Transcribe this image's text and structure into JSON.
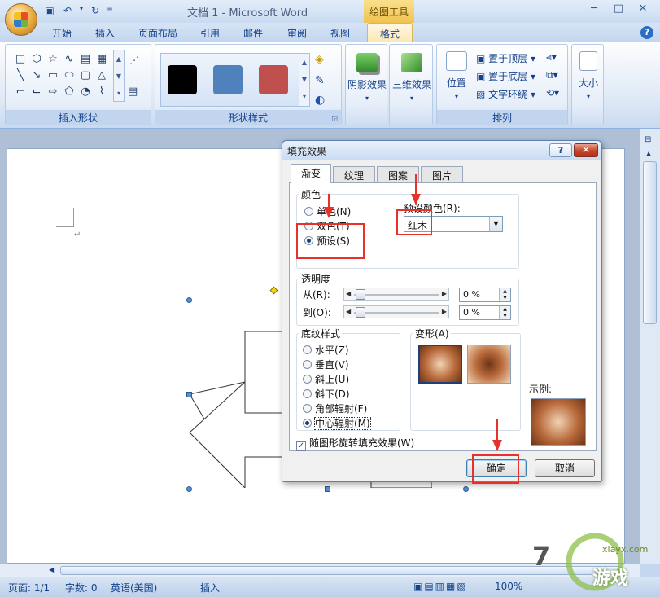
{
  "window": {
    "title": "文档 1 - Microsoft Word",
    "contextual_tab_header": "绘图工具"
  },
  "tabs": [
    {
      "label": "开始"
    },
    {
      "label": "插入"
    },
    {
      "label": "页面布局"
    },
    {
      "label": "引用"
    },
    {
      "label": "邮件"
    },
    {
      "label": "审阅"
    },
    {
      "label": "视图"
    },
    {
      "label": "格式",
      "active": true
    }
  ],
  "ribbon": {
    "insert_shapes_label": "插入形状",
    "shape_styles_label": "形状样式",
    "arrange_label": "排列",
    "shadow_effects": "阴影效果",
    "three_d_effects": "三维效果",
    "position": "位置",
    "bring_to_front": "置于顶层",
    "send_to_back": "置于底层",
    "text_wrapping": "文字环绕",
    "size": "大小",
    "swatch_colors": [
      "#000000",
      "#4f81bd",
      "#c0504d"
    ]
  },
  "dialog": {
    "title": "填充效果",
    "help": "?",
    "tabs": [
      "渐变",
      "纹理",
      "图案",
      "图片"
    ],
    "color_section": "颜色",
    "color_options": [
      "单色(N)",
      "双色(T)",
      "预设(S)"
    ],
    "preset_color_label": "预设颜色(R):",
    "preset_color_value": "红木",
    "transparency_section": "透明度",
    "from_label": "从(R):",
    "to_label": "到(O):",
    "from_value": "0 %",
    "to_value": "0 %",
    "shading_section": "底纹样式",
    "shading_options": [
      "水平(Z)",
      "垂直(V)",
      "斜上(U)",
      "斜下(D)",
      "角部辐射(F)",
      "中心辐射(M)"
    ],
    "variants_label": "变形(A)",
    "sample_label": "示例:",
    "rotate_with_shape": "随图形旋转填充效果(W)",
    "ok": "确定",
    "cancel": "取消"
  },
  "statusbar": {
    "page": "页面: 1/1",
    "words": "字数: 0",
    "language": "英语(美国)",
    "mode": "插入",
    "zoom": "100%"
  },
  "watermark": {
    "num": "7",
    "brand": "游戏",
    "site": "xiayx.com"
  }
}
